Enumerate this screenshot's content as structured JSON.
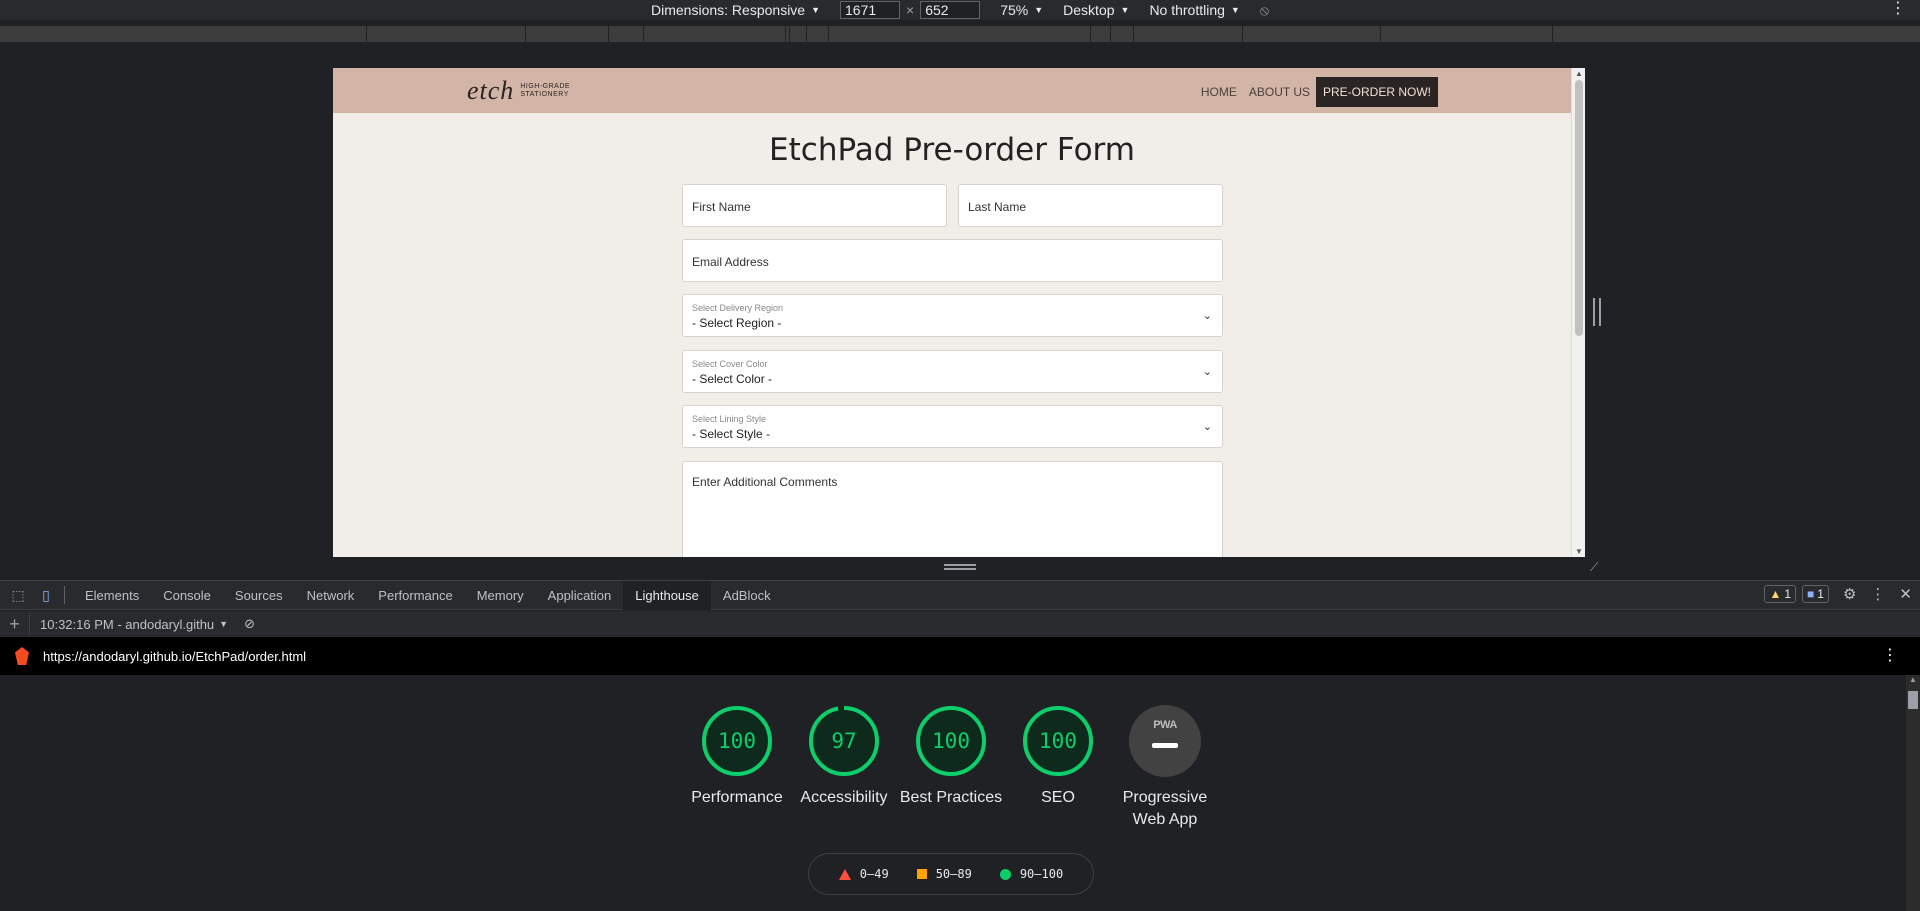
{
  "device_toolbar": {
    "dimensions_label": "Dimensions: Responsive",
    "width": "1671",
    "height": "652",
    "times": "×",
    "zoom": "75%",
    "device_type": "Desktop",
    "throttling": "No throttling"
  },
  "site": {
    "logo_word": "etch",
    "logo_tagline_1": "HIGH-GRADE",
    "logo_tagline_2": "STATIONERY",
    "nav": {
      "home": "HOME",
      "about": "ABOUT US",
      "preorder": "PRE-ORDER NOW!"
    },
    "form": {
      "title": "EtchPad Pre-order Form",
      "first_name": "First Name",
      "last_name": "Last Name",
      "email": "Email Address",
      "region_label": "Select Delivery Region",
      "region_value": "- Select Region -",
      "color_label": "Select Cover Color",
      "color_value": "- Select Color -",
      "lining_label": "Select Lining Style",
      "lining_value": "- Select Style -",
      "comments": "Enter Additional Comments"
    }
  },
  "devtools": {
    "tabs": [
      "Elements",
      "Console",
      "Sources",
      "Network",
      "Performance",
      "Memory",
      "Application",
      "Lighthouse",
      "AdBlock"
    ],
    "active_tab": "Lighthouse",
    "warnings_count": "1",
    "messages_count": "1",
    "session": "10:32:16 PM - andodaryl.githu",
    "url": "https://andodaryl.github.io/EtchPad/order.html"
  },
  "lighthouse": {
    "scores": [
      {
        "value": 100,
        "label": "Performance"
      },
      {
        "value": 97,
        "label": "Accessibility"
      },
      {
        "value": 100,
        "label": "Best Practices"
      },
      {
        "value": 100,
        "label": "SEO"
      }
    ],
    "pwa": {
      "badge": "PWA",
      "label": "Progressive Web App"
    },
    "legend": {
      "fail": "0–49",
      "average": "50–89",
      "pass": "90–100"
    },
    "colors": {
      "pass": "#0cce6b",
      "average": "#ffa400",
      "fail": "#ff4e42"
    }
  }
}
